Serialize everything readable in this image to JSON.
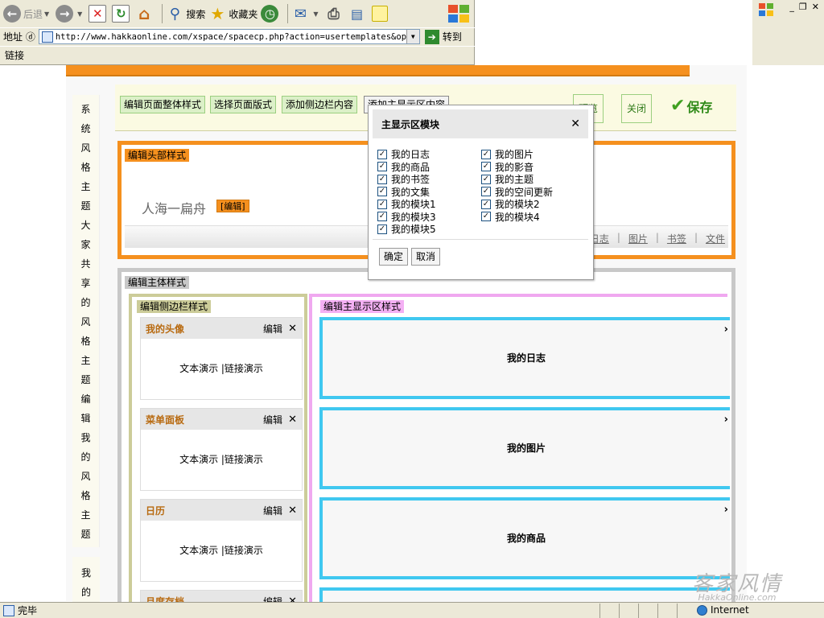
{
  "browser": {
    "toolbar": {
      "back_label": "后退",
      "search_label": "搜索",
      "favorites_label": "收藏夹"
    },
    "address_label": "地址 ⓓ",
    "address_url": "http://www.hakkaonline.com/xspace/spacecp.php?action=usertemplates&op=dra",
    "go_label": "转到",
    "links_label": "链接",
    "status_text": "完毕",
    "zone_text": "Internet"
  },
  "left_nav": {
    "text_chars": [
      "系",
      "统",
      "风",
      "格",
      "主",
      "题",
      "大",
      "家",
      "共",
      "享",
      "的",
      "风",
      "格",
      "主",
      "题",
      "编",
      "辑",
      "我",
      "的",
      "风",
      "格",
      "主",
      "题"
    ],
    "text2_chars": [
      "我",
      "的"
    ]
  },
  "editor_toolbar": {
    "edit_page_style": "编辑页面整体样式",
    "select_layout": "选择页面版式",
    "add_sidebar": "添加侧边栏内容",
    "add_main": "添加主显示区内容",
    "preview": "预览",
    "close": "关闭",
    "save": "保存"
  },
  "header_section": {
    "tag": "编辑头部样式",
    "site_name": "人海一扁舟",
    "edit_label": "[编辑]",
    "nav_links": [
      "日志",
      "图片",
      "书签",
      "文件"
    ]
  },
  "body_section": {
    "tag": "编辑主体样式",
    "sidebar_tag": "编辑侧边栏样式",
    "main_tag": "编辑主显示区样式",
    "sidebar_modules": [
      {
        "title": "我的头像",
        "edit": "编辑",
        "body": "文本演示 |链接演示"
      },
      {
        "title": "菜单面板",
        "edit": "编辑",
        "body": "文本演示 |链接演示"
      },
      {
        "title": "日历",
        "edit": "编辑",
        "body": "文本演示 |链接演示"
      },
      {
        "title": "月度存档",
        "edit": "编辑"
      }
    ],
    "main_modules": [
      "我的日志",
      "我的图片",
      "我的商品"
    ]
  },
  "modal": {
    "title": "主显示区模块",
    "options_left": [
      "我的日志",
      "我的商品",
      "我的书签",
      "我的文集",
      "我的模块1",
      "我的模块3",
      "我的模块5"
    ],
    "options_right": [
      "我的图片",
      "我的影音",
      "我的主题",
      "我的空间更新",
      "我的模块2",
      "我的模块4"
    ],
    "confirm": "确定",
    "cancel": "取消"
  },
  "watermark": {
    "main": "客家风情",
    "sub": "HakkaOnline.com"
  },
  "colors": {
    "header_border": "#f5901e",
    "sidebar_border": "#cccc99",
    "main_border": "#f0a8f0",
    "main_module_border": "#40c8f0",
    "body_border": "#c8c8c8"
  }
}
